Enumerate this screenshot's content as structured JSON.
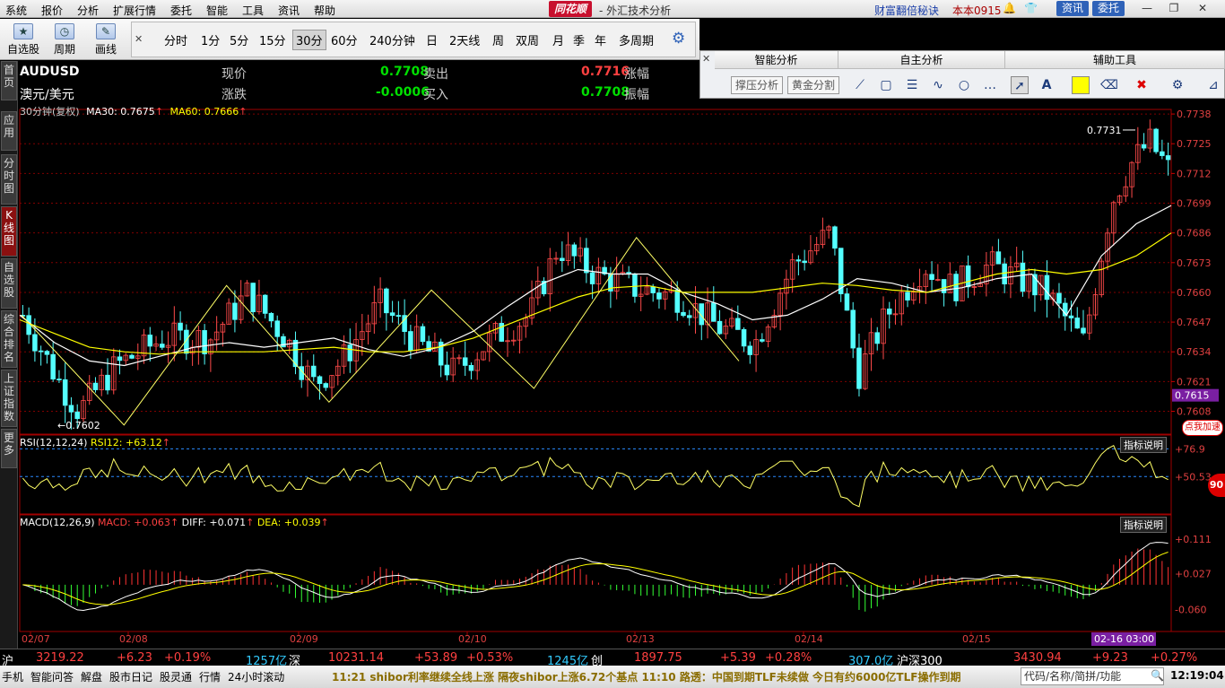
{
  "menu": [
    "系统",
    "报价",
    "分析",
    "扩展行情",
    "委托",
    "智能",
    "工具",
    "资讯",
    "帮助"
  ],
  "brand": "同花顺",
  "brand_sub": "- 外汇技术分析",
  "promo": "财富翻倍秘诀",
  "user": "本本0915",
  "top_buttons": {
    "news": "资讯",
    "trade": "委托"
  },
  "toolbar": {
    "self_select": "自选股",
    "period": "周期",
    "draw": "画线"
  },
  "periods": [
    "分时",
    "1分",
    "5分",
    "15分",
    "30分",
    "60分",
    "240分钟",
    "日",
    "2天线",
    "周",
    "双周",
    "月",
    "季",
    "年",
    "多周期"
  ],
  "active_period": "30分",
  "panel": {
    "smart_title": "智能分析",
    "self_title": "自主分析",
    "aux_title": "辅助工具",
    "btn_support": "撑压分析",
    "btn_golden": "黄金分割"
  },
  "left_tabs": [
    "首页",
    "应用",
    "分时图",
    "K线图",
    "自选股",
    "综合排名",
    "上证指数",
    "更多"
  ],
  "active_tab": "K线图",
  "quote": {
    "symbol": "AUDUSD",
    "name": "澳元/美元",
    "price_label": "现价",
    "price": "0.7708",
    "change_label": "涨跌",
    "change": "-0.0006",
    "sell_label": "卖出",
    "sell": "0.7716",
    "buy_label": "买入",
    "buy": "0.7708",
    "pct_label": "涨幅",
    "amp_label": "振幅"
  },
  "main_legend": {
    "period": "30分钟(复权)",
    "ma30": "MA30: 0.7675",
    "ma60": "MA60: 0.7666"
  },
  "rsi_legend": {
    "title": "RSI(12,12,24)",
    "value": "RSI12: +63.12"
  },
  "macd_legend": {
    "title": "MACD(12,26,9)",
    "macd": "MACD: +0.063",
    "diff": "DIFF: +0.071",
    "dea": "DEA: +0.039"
  },
  "indicator_help": "指标说明",
  "promo_badge": "点我加速",
  "promo_number": "90",
  "statusbar": {
    "sh_label": "沪",
    "sh_val": "3219.22",
    "sh_chg": "+6.23",
    "sh_pct": "+0.19%",
    "sh_vol": "1257亿",
    "sz_label": "深",
    "sz_val": "10231.14",
    "sz_chg": "+53.89",
    "sz_pct": "+0.53%",
    "sz_vol": "1245亿",
    "cy_label": "创",
    "cy_val": "1897.75",
    "cy_chg": "+5.39",
    "cy_pct": "+0.28%",
    "cy_vol": "307.0亿",
    "hs_label": "沪深300",
    "hs_val": "3430.94",
    "hs_chg": "+9.23",
    "hs_pct": "+0.27%"
  },
  "bottom_nav": [
    "手机",
    "智能问答",
    "解盘",
    "股市日记",
    "股灵通",
    "行情",
    "24小时滚动"
  ],
  "ticker_text": "11:21 shibor利率继续全线上涨 隔夜shibor上涨6.72个基点        11:10 路透：中国到期TLF未续做 今日有约6000亿TLF操作到期",
  "search_placeholder": "代码/名称/简拼/功能",
  "clock": "12:19:04",
  "chart_data": {
    "type": "candlestick",
    "instrument": "AUDUSD",
    "interval": "30分钟",
    "x_tick_labels": [
      "02/07",
      "02/08",
      "02/09",
      "02/10",
      "02/13",
      "02/14",
      "02/15"
    ],
    "cursor_time": "02-16 03:00",
    "price_axis": [
      "0.7738",
      "0.7725",
      "0.7712",
      "0.7699",
      "0.7686",
      "0.7673",
      "0.7660",
      "0.7647",
      "0.7634",
      "0.7621",
      "0.7608"
    ],
    "price_range": [
      0.7598,
      0.774
    ],
    "last_price_tag": "0.7615",
    "annotations": {
      "high": "0.7731",
      "low": "0.7602"
    },
    "zigzag": [
      0.765,
      0.7602,
      0.7663,
      0.7612,
      0.7661,
      0.7618,
      0.7684,
      0.763
    ],
    "ma30_path": [
      0.765,
      0.7638,
      0.763,
      0.7628,
      0.7632,
      0.7636,
      0.7638,
      0.7636,
      0.7638,
      0.764,
      0.7635,
      0.7632,
      0.7636,
      0.7643,
      0.7654,
      0.7664,
      0.767,
      0.7668,
      0.7668,
      0.766,
      0.7655,
      0.7648,
      0.765,
      0.7657,
      0.7666,
      0.7664,
      0.766,
      0.7662,
      0.7666,
      0.7668,
      0.765,
      0.7676,
      0.769,
      0.7698
    ],
    "ma60_path": [
      0.7648,
      0.7642,
      0.7636,
      0.7634,
      0.7633,
      0.7634,
      0.7634,
      0.7634,
      0.7635,
      0.7636,
      0.7634,
      0.7634,
      0.7636,
      0.764,
      0.7646,
      0.7652,
      0.7658,
      0.7662,
      0.7663,
      0.766,
      0.766,
      0.766,
      0.7662,
      0.7664,
      0.7663,
      0.7661,
      0.766,
      0.7664,
      0.7668,
      0.767,
      0.7668,
      0.767,
      0.7676,
      0.7686
    ],
    "rsi_axis": [
      "+76.9",
      "+50.53"
    ],
    "macd_axis": [
      "+0.111",
      "+0.027",
      "-0.060"
    ]
  }
}
